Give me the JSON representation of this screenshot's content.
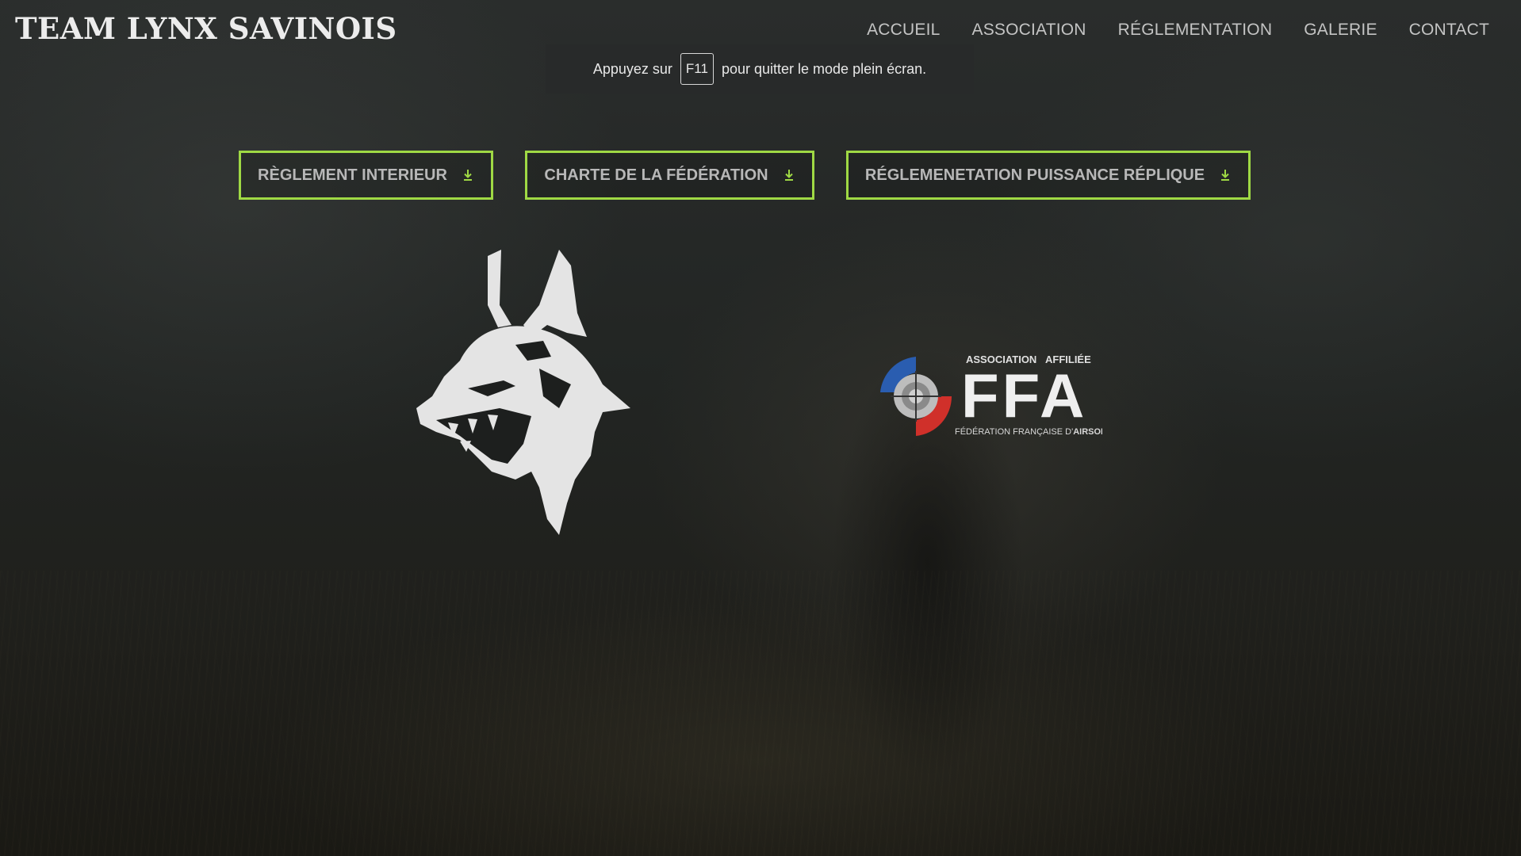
{
  "header": {
    "brand": "TEAM LYNX SAVINOIS",
    "nav": [
      "ACCUEIL",
      "ASSOCIATION",
      "RÉGLEMENTATION",
      "GALERIE",
      "CONTACT"
    ]
  },
  "fullscreen_notice": {
    "before": "Appuyez sur",
    "key": "F11",
    "after": "pour quitter le mode plein écran."
  },
  "downloads": [
    {
      "label": "RÈGLEMENT INTERIEUR",
      "icon": "download-icon"
    },
    {
      "label": "CHARTE DE LA FÉDÉRATION",
      "icon": "download-icon"
    },
    {
      "label": "RÉGLEMENETATION PUISSANCE RÉPLIQUE",
      "icon": "download-icon"
    }
  ],
  "logos": {
    "lynx": "lynx-logo",
    "ffa": {
      "top_left": "ASSOCIATION",
      "top_right": "AFFILIÉE",
      "mark": "FFA",
      "subtitle_prefix": "FÉDÉRATION FRANÇAISE D'",
      "subtitle_strong": "AIRSOFT"
    }
  },
  "colors": {
    "accent": "#9fd944",
    "nav_text": "#c4c4c4",
    "ffa_blue": "#2a5db0",
    "ffa_red": "#d0302a"
  }
}
